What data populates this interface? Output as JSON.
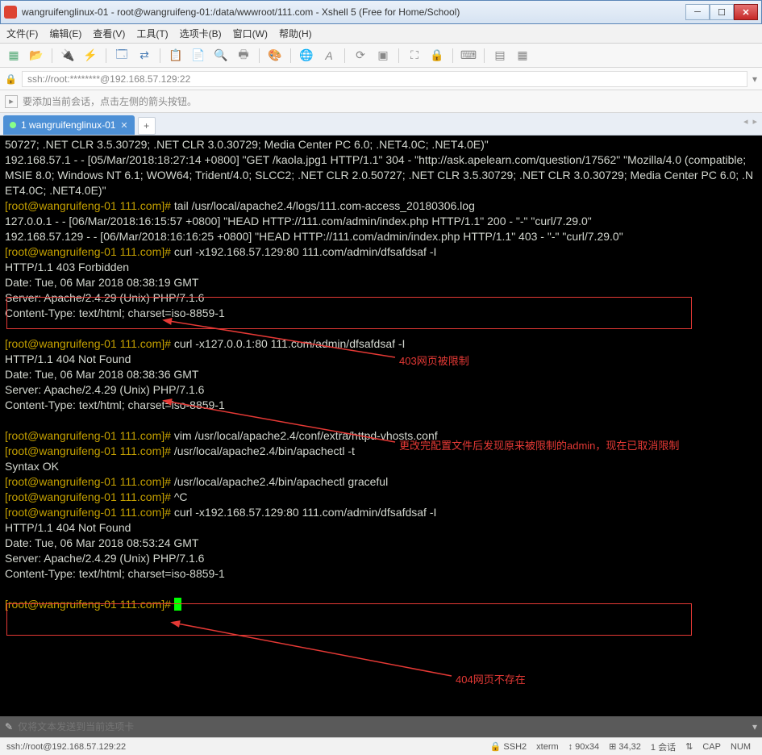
{
  "window": {
    "title": "wangruifenglinux-01 - root@wangruifeng-01:/data/wwwroot/111.com - Xshell 5 (Free for Home/School)"
  },
  "menu": {
    "file": "文件(F)",
    "edit": "编辑(E)",
    "view": "查看(V)",
    "tools": "工具(T)",
    "tab": "选项卡(B)",
    "window": "窗口(W)",
    "help": "帮助(H)"
  },
  "address": {
    "value": "ssh://root:********@192.168.57.129:22"
  },
  "hint": {
    "text": "要添加当前会话，点击左侧的箭头按钮。"
  },
  "tab": {
    "label": "1 wangruifenglinux-01"
  },
  "terminal_lines": [
    {
      "t": "50727; .NET CLR 3.5.30729; .NET CLR 3.0.30729; Media Center PC 6.0; .NET4.0C; .NET4.0E)\""
    },
    {
      "t": "192.168.57.1 - - [05/Mar/2018:18:27:14 +0800] \"GET /kaola.jpg1 HTTP/1.1\" 304 - \"http://ask.apelearn.com/question/17562\" \"Mozilla/4.0 (compatible; MSIE 8.0; Windows NT 6.1; WOW64; Trident/4.0; SLCC2; .NET CLR 2.0.50727; .NET CLR 3.5.30729; .NET CLR 3.0.30729; Media Center PC 6.0; .NET4.0C; .NET4.0E)\""
    },
    {
      "p": "[root@wangruifeng-01 111.com]# ",
      "c": "tail /usr/local/apache2.4/logs/111.com-access_20180306.log"
    },
    {
      "t": "127.0.0.1 - - [06/Mar/2018:16:15:57 +0800] \"HEAD HTTP://111.com/admin/index.php HTTP/1.1\" 200 - \"-\" \"curl/7.29.0\""
    },
    {
      "t": "192.168.57.129 - - [06/Mar/2018:16:16:25 +0800] \"HEAD HTTP://111.com/admin/index.php HTTP/1.1\" 403 - \"-\" \"curl/7.29.0\""
    },
    {
      "p": "[root@wangruifeng-01 111.com]# ",
      "c": "curl -x192.168.57.129:80 111.com/admin/dfsafdsaf -I"
    },
    {
      "t": "HTTP/1.1 403 Forbidden"
    },
    {
      "t": "Date: Tue, 06 Mar 2018 08:38:19 GMT"
    },
    {
      "t": "Server: Apache/2.4.29 (Unix) PHP/7.1.6"
    },
    {
      "t": "Content-Type: text/html; charset=iso-8859-1"
    },
    {
      "t": ""
    },
    {
      "p": "[root@wangruifeng-01 111.com]# ",
      "c": "curl -x127.0.0.1:80 111.com/admin/dfsafdsaf -I"
    },
    {
      "t": "HTTP/1.1 404 Not Found"
    },
    {
      "t": "Date: Tue, 06 Mar 2018 08:38:36 GMT"
    },
    {
      "t": "Server: Apache/2.4.29 (Unix) PHP/7.1.6"
    },
    {
      "t": "Content-Type: text/html; charset=iso-8859-1"
    },
    {
      "t": ""
    },
    {
      "p": "[root@wangruifeng-01 111.com]# ",
      "c": "vim /usr/local/apache2.4/conf/extra/httpd-vhosts.conf"
    },
    {
      "p": "[root@wangruifeng-01 111.com]# ",
      "c": "/usr/local/apache2.4/bin/apachectl -t"
    },
    {
      "t": "Syntax OK"
    },
    {
      "p": "[root@wangruifeng-01 111.com]# ",
      "c": "/usr/local/apache2.4/bin/apachectl graceful"
    },
    {
      "p": "[root@wangruifeng-01 111.com]# ",
      "c": "^C"
    },
    {
      "p": "[root@wangruifeng-01 111.com]# ",
      "c": "curl -x192.168.57.129:80 111.com/admin/dfsafdsaf -I"
    },
    {
      "t": "HTTP/1.1 404 Not Found"
    },
    {
      "t": "Date: Tue, 06 Mar 2018 08:53:24 GMT"
    },
    {
      "t": "Server: Apache/2.4.29 (Unix) PHP/7.1.6"
    },
    {
      "t": "Content-Type: text/html; charset=iso-8859-1"
    },
    {
      "t": ""
    },
    {
      "p": "[root@wangruifeng-01 111.com]# ",
      "cursor": true
    }
  ],
  "annotations": {
    "a1": "403网页被限制",
    "a2": "更改完配置文件后发现原来被限制的admin，现在已取消限制",
    "a3": "404网页不存在"
  },
  "bottom": {
    "placeholder": "仅将文本发送到当前选项卡"
  },
  "status": {
    "conn": "ssh://root@192.168.57.129:22",
    "ssh": "SSH2",
    "term": "xterm",
    "size": "90x34",
    "pos": "34,32",
    "sess": "1 会话",
    "cap": "CAP",
    "num": "NUM"
  }
}
